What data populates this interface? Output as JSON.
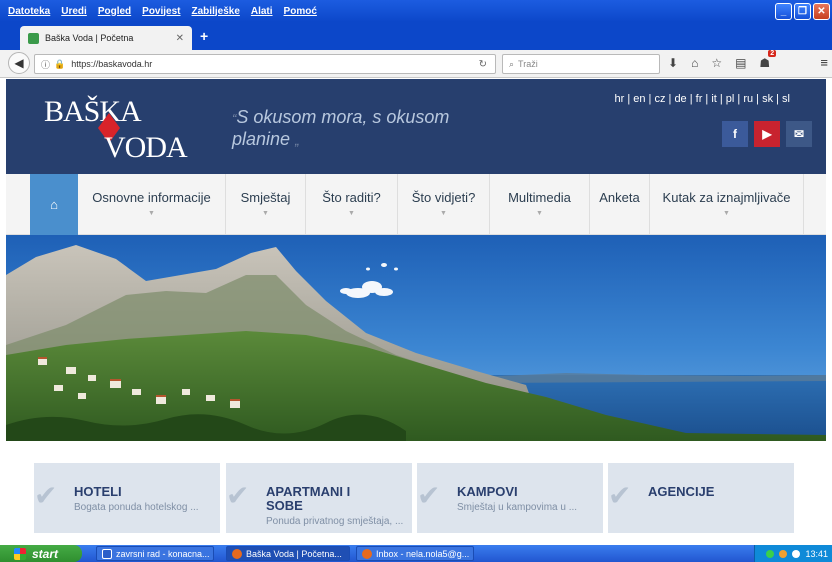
{
  "window": {
    "menu": [
      "Datoteka",
      "Uredi",
      "Pogled",
      "Povijest",
      "Zabilješke",
      "Alati",
      "Pomoć"
    ]
  },
  "tabs": [
    {
      "label": "Baška Voda | Početna"
    }
  ],
  "browser": {
    "url": "https://baskavoda.hr",
    "search_placeholder": "Traži",
    "notification_count": "2"
  },
  "site": {
    "logo_top": "BAŠKA",
    "logo_bottom": "VODA",
    "slogan_line1": "S okusom mora, s okusom",
    "slogan_line2": "planine",
    "languages": "hr | en | cz | de | fr | it | pl | ru | sk | sl",
    "social": {
      "facebook": "f"
    },
    "nav": [
      {
        "label": "Osnovne informacije",
        "has_sub": true
      },
      {
        "label": "Smještaj",
        "has_sub": true
      },
      {
        "label": "Što raditi?",
        "has_sub": true
      },
      {
        "label": "Što vidjeti?",
        "has_sub": true
      },
      {
        "label": "Multimedia",
        "has_sub": true
      },
      {
        "label": "Anketa",
        "has_sub": false
      },
      {
        "label": "Kutak za iznajmljivače",
        "has_sub": true
      }
    ],
    "cards": [
      {
        "title": "HOTELI",
        "subtitle": "Bogata ponuda hotelskog ..."
      },
      {
        "title": "APARTMANI I SOBE",
        "subtitle": "Ponuda privatnog smještaja, ..."
      },
      {
        "title": "KAMPOVI",
        "subtitle": "Smještaj u kampovima u ..."
      },
      {
        "title": "AGENCIJE",
        "subtitle": ""
      }
    ]
  },
  "taskbar": {
    "start": "start",
    "items": [
      {
        "label": "zavrsni rad - konacna..."
      },
      {
        "label": "Baška Voda | Početna..."
      },
      {
        "label": "Inbox - nela.nola5@g..."
      }
    ],
    "clock": "13:41"
  },
  "colors": {
    "header_bg": "#273f6e",
    "nav_active": "#4a8fcd",
    "card_bg": "#dde4ed",
    "card_title": "#2a3f6e"
  }
}
